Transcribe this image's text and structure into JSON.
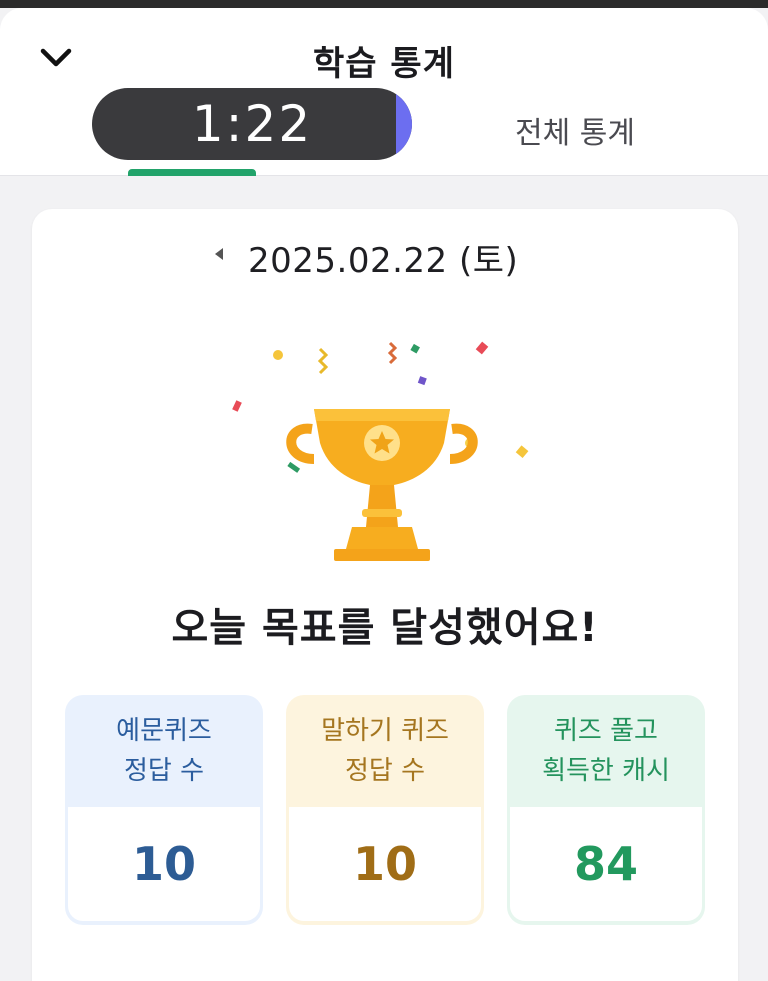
{
  "header": {
    "title": "학습 통계",
    "back_icon": "chevron-down-icon",
    "timer": "1:22",
    "tab_all_label": "전체 통계"
  },
  "date": {
    "prev_icon": "caret-left-icon",
    "label": "2025.02.22 (토)"
  },
  "achievement": {
    "icon": "trophy-icon",
    "headline": "오늘 목표를 달성했어요!"
  },
  "stats": [
    {
      "label_line1": "예문퀴즈",
      "label_line2": "정답 수",
      "value": "10",
      "accent": "#2d5c94"
    },
    {
      "label_line1": "말하기 퀴즈",
      "label_line2": "정답 수",
      "value": "10",
      "accent": "#a06d16"
    },
    {
      "label_line1": "퀴즈 풀고",
      "label_line2": "획득한 캐시",
      "value": "84",
      "accent": "#22995e"
    }
  ],
  "colors": {
    "brand_green": "#22a36a",
    "timer_bg": "#3a3a3d",
    "timer_accent": "#6c6ef0",
    "trophy": "#f7ad1f"
  }
}
